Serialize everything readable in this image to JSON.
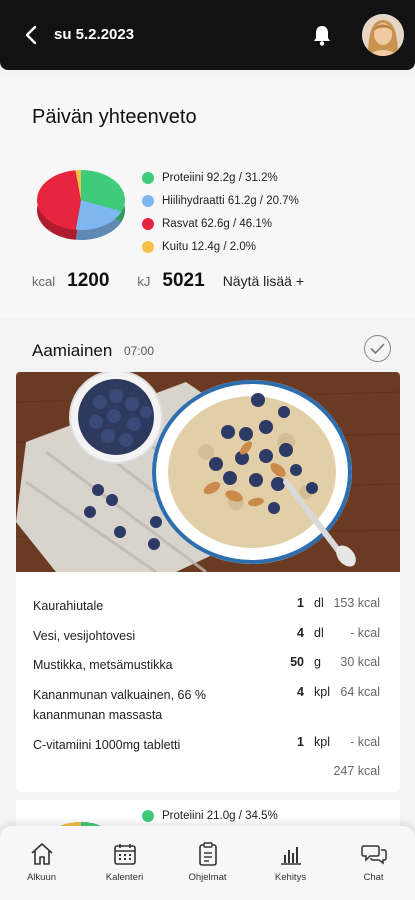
{
  "header": {
    "date": "su 5.2.2023",
    "back_icon": "chevron-left-icon",
    "bell_icon": "bell-icon"
  },
  "summary": {
    "title": "Päivän yhteenveto",
    "legend": [
      {
        "label": "Proteiini 92.2g / 31.2%",
        "color": "#3ecb7a"
      },
      {
        "label": "Hiilihydraatti 61.2g / 20.7%",
        "color": "#7fb8f0"
      },
      {
        "label": "Rasvat 62.6g / 46.1%",
        "color": "#e8253f"
      },
      {
        "label": "Kuitu 12.4g / 2.0%",
        "color": "#f5c046"
      }
    ],
    "kcal_unit": "kcal",
    "kcal_value": "1200",
    "kj_unit": "kJ",
    "kj_value": "5021",
    "more_label": "Näytä lisää +"
  },
  "chart_data": {
    "type": "pie",
    "categories": [
      "Proteiini",
      "Hiilihydraatti",
      "Rasvat",
      "Kuitu"
    ],
    "values": [
      31.2,
      20.7,
      46.1,
      2.0
    ],
    "colors": [
      "#3ecb7a",
      "#7fb8f0",
      "#e8253f",
      "#f5c046"
    ]
  },
  "meal": {
    "name": "Aamiainen",
    "time": "07:00",
    "items": [
      {
        "name": "Kaurahiutale",
        "amount": "1",
        "unit": "dl",
        "kcal": "153 kcal"
      },
      {
        "name": "Vesi, vesijohtovesi",
        "amount": "4",
        "unit": "dl",
        "kcal": "- kcal"
      },
      {
        "name": "Mustikka, metsämustikka",
        "amount": "50",
        "unit": "g",
        "kcal": "30 kcal"
      },
      {
        "name": "Kananmunan valkuainen, 66 % kananmunan massasta",
        "amount": "4",
        "unit": "kpl",
        "kcal": "64 kcal"
      },
      {
        "name": "C-vitamiini 1000mg tabletti",
        "amount": "1",
        "unit": "kpl",
        "kcal": "- kcal"
      }
    ],
    "total": "247 kcal"
  },
  "next_meal": {
    "legend_first": {
      "label": "Proteiini 21.0g / 34.5%",
      "color": "#3ecb7a"
    }
  },
  "nav": [
    {
      "label": "Alkuun",
      "icon": "home-icon"
    },
    {
      "label": "Kalenteri",
      "icon": "calendar-icon"
    },
    {
      "label": "Ohjelmat",
      "icon": "clipboard-icon"
    },
    {
      "label": "Kehitys",
      "icon": "bar-chart-icon"
    },
    {
      "label": "Chat",
      "icon": "chat-icon"
    }
  ]
}
